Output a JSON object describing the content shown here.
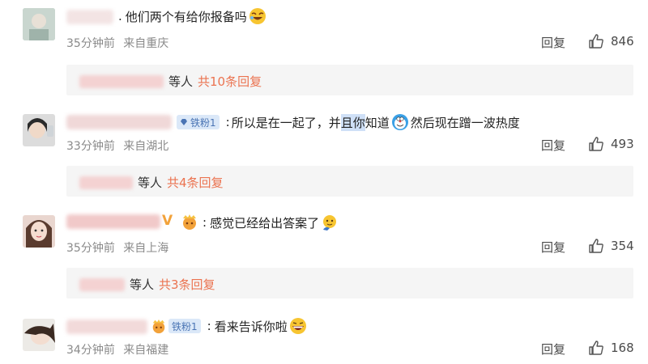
{
  "comments": [
    {
      "text": "他们两个有给你报备吗",
      "time": "35分钟前",
      "location": "来自重庆",
      "reply_label": "回复",
      "likes": "846",
      "sub": {
        "etc": "等人",
        "count": "共10条回复"
      }
    },
    {
      "badge": "铁粉1",
      "text_a": "所以是在一起了，并",
      "text_hl": "且你",
      "text_b": "知道",
      "text_c": "然后现在蹭一波热度",
      "time": "33分钟前",
      "location": "来自湖北",
      "reply_label": "回复",
      "likes": "493",
      "sub": {
        "etc": "等人",
        "count": "共4条回复"
      }
    },
    {
      "name_suffix": "V",
      "text": "感觉已经给出答案了",
      "time": "35分钟前",
      "location": "来自上海",
      "reply_label": "回复",
      "likes": "354",
      "sub": {
        "etc": "等人",
        "count": "共3条回复"
      }
    },
    {
      "badge": "铁粉1",
      "text": "看来告诉你啦",
      "time": "34分钟前",
      "location": "来自福建",
      "reply_label": "回复",
      "likes": "168"
    }
  ],
  "colors": {
    "accent": "#eb7350",
    "fan_badge_bg": "#dbe8f8",
    "sub_bg": "#f5f5f5"
  },
  "icons": [
    "thumbs-up-icon",
    "crown-icon",
    "diamond-icon",
    "laugh-emoji-icon",
    "doraemon-emoji-icon",
    "thinking-emoji-icon",
    "grin-emoji-icon"
  ]
}
